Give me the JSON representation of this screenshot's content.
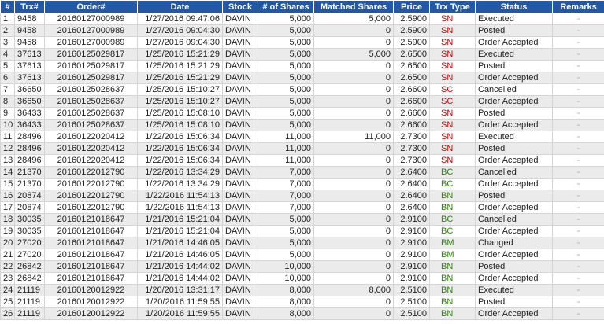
{
  "headers": [
    "#",
    "Trx#",
    "Order#",
    "Date",
    "Stock",
    "# of Shares",
    "Matched Shares",
    "Price",
    "Trx Type",
    "Status",
    "Remarks"
  ],
  "colors": {
    "header_bg": "#2358a6",
    "sell": "#d40000",
    "buy": "#2a8a00",
    "alt_row": "#ebebeb"
  },
  "rows": [
    {
      "no": "1",
      "trx": "9458",
      "order": "20160127000989",
      "date": "1/27/2016 09:47:06",
      "stock": "DAVIN",
      "shares": "5,000",
      "matched": "5,000",
      "price": "2.5900",
      "type": "SN",
      "status": "Executed",
      "remarks": "-"
    },
    {
      "no": "2",
      "trx": "9458",
      "order": "20160127000989",
      "date": "1/27/2016 09:04:30",
      "stock": "DAVIN",
      "shares": "5,000",
      "matched": "0",
      "price": "2.5900",
      "type": "SN",
      "status": "Posted",
      "remarks": "-"
    },
    {
      "no": "3",
      "trx": "9458",
      "order": "20160127000989",
      "date": "1/27/2016 09:04:30",
      "stock": "DAVIN",
      "shares": "5,000",
      "matched": "0",
      "price": "2.5900",
      "type": "SN",
      "status": "Order Accepted",
      "remarks": "-"
    },
    {
      "no": "4",
      "trx": "37613",
      "order": "20160125029817",
      "date": "1/25/2016 15:21:29",
      "stock": "DAVIN",
      "shares": "5,000",
      "matched": "5,000",
      "price": "2.6500",
      "type": "SN",
      "status": "Executed",
      "remarks": "-"
    },
    {
      "no": "5",
      "trx": "37613",
      "order": "20160125029817",
      "date": "1/25/2016 15:21:29",
      "stock": "DAVIN",
      "shares": "5,000",
      "matched": "0",
      "price": "2.6500",
      "type": "SN",
      "status": "Posted",
      "remarks": "-"
    },
    {
      "no": "6",
      "trx": "37613",
      "order": "20160125029817",
      "date": "1/25/2016 15:21:29",
      "stock": "DAVIN",
      "shares": "5,000",
      "matched": "0",
      "price": "2.6500",
      "type": "SN",
      "status": "Order Accepted",
      "remarks": "-"
    },
    {
      "no": "7",
      "trx": "36650",
      "order": "20160125028637",
      "date": "1/25/2016 15:10:27",
      "stock": "DAVIN",
      "shares": "5,000",
      "matched": "0",
      "price": "2.6600",
      "type": "SC",
      "status": "Cancelled",
      "remarks": "-"
    },
    {
      "no": "8",
      "trx": "36650",
      "order": "20160125028637",
      "date": "1/25/2016 15:10:27",
      "stock": "DAVIN",
      "shares": "5,000",
      "matched": "0",
      "price": "2.6600",
      "type": "SC",
      "status": "Order Accepted",
      "remarks": "-"
    },
    {
      "no": "9",
      "trx": "36433",
      "order": "20160125028637",
      "date": "1/25/2016 15:08:10",
      "stock": "DAVIN",
      "shares": "5,000",
      "matched": "0",
      "price": "2.6600",
      "type": "SN",
      "status": "Posted",
      "remarks": "-"
    },
    {
      "no": "10",
      "trx": "36433",
      "order": "20160125028637",
      "date": "1/25/2016 15:08:10",
      "stock": "DAVIN",
      "shares": "5,000",
      "matched": "0",
      "price": "2.6600",
      "type": "SN",
      "status": "Order Accepted",
      "remarks": "-"
    },
    {
      "no": "11",
      "trx": "28496",
      "order": "20160122020412",
      "date": "1/22/2016 15:06:34",
      "stock": "DAVIN",
      "shares": "11,000",
      "matched": "11,000",
      "price": "2.7300",
      "type": "SN",
      "status": "Executed",
      "remarks": "-"
    },
    {
      "no": "12",
      "trx": "28496",
      "order": "20160122020412",
      "date": "1/22/2016 15:06:34",
      "stock": "DAVIN",
      "shares": "11,000",
      "matched": "0",
      "price": "2.7300",
      "type": "SN",
      "status": "Posted",
      "remarks": "-"
    },
    {
      "no": "13",
      "trx": "28496",
      "order": "20160122020412",
      "date": "1/22/2016 15:06:34",
      "stock": "DAVIN",
      "shares": "11,000",
      "matched": "0",
      "price": "2.7300",
      "type": "SN",
      "status": "Order Accepted",
      "remarks": "-"
    },
    {
      "no": "14",
      "trx": "21370",
      "order": "20160122012790",
      "date": "1/22/2016 13:34:29",
      "stock": "DAVIN",
      "shares": "7,000",
      "matched": "0",
      "price": "2.6400",
      "type": "BC",
      "status": "Cancelled",
      "remarks": "-"
    },
    {
      "no": "15",
      "trx": "21370",
      "order": "20160122012790",
      "date": "1/22/2016 13:34:29",
      "stock": "DAVIN",
      "shares": "7,000",
      "matched": "0",
      "price": "2.6400",
      "type": "BC",
      "status": "Order Accepted",
      "remarks": "-"
    },
    {
      "no": "16",
      "trx": "20874",
      "order": "20160122012790",
      "date": "1/22/2016 11:54:13",
      "stock": "DAVIN",
      "shares": "7,000",
      "matched": "0",
      "price": "2.6400",
      "type": "BN",
      "status": "Posted",
      "remarks": "-"
    },
    {
      "no": "17",
      "trx": "20874",
      "order": "20160122012790",
      "date": "1/22/2016 11:54:13",
      "stock": "DAVIN",
      "shares": "7,000",
      "matched": "0",
      "price": "2.6400",
      "type": "BN",
      "status": "Order Accepted",
      "remarks": "-"
    },
    {
      "no": "18",
      "trx": "30035",
      "order": "20160121018647",
      "date": "1/21/2016 15:21:04",
      "stock": "DAVIN",
      "shares": "5,000",
      "matched": "0",
      "price": "2.9100",
      "type": "BC",
      "status": "Cancelled",
      "remarks": "-"
    },
    {
      "no": "19",
      "trx": "30035",
      "order": "20160121018647",
      "date": "1/21/2016 15:21:04",
      "stock": "DAVIN",
      "shares": "5,000",
      "matched": "0",
      "price": "2.9100",
      "type": "BC",
      "status": "Order Accepted",
      "remarks": "-"
    },
    {
      "no": "20",
      "trx": "27020",
      "order": "20160121018647",
      "date": "1/21/2016 14:46:05",
      "stock": "DAVIN",
      "shares": "5,000",
      "matched": "0",
      "price": "2.9100",
      "type": "BM",
      "status": "Changed",
      "remarks": "-"
    },
    {
      "no": "21",
      "trx": "27020",
      "order": "20160121018647",
      "date": "1/21/2016 14:46:05",
      "stock": "DAVIN",
      "shares": "5,000",
      "matched": "0",
      "price": "2.9100",
      "type": "BM",
      "status": "Order Accepted",
      "remarks": "-"
    },
    {
      "no": "22",
      "trx": "26842",
      "order": "20160121018647",
      "date": "1/21/2016 14:44:02",
      "stock": "DAVIN",
      "shares": "10,000",
      "matched": "0",
      "price": "2.9100",
      "type": "BN",
      "status": "Posted",
      "remarks": "-"
    },
    {
      "no": "23",
      "trx": "26842",
      "order": "20160121018647",
      "date": "1/21/2016 14:44:02",
      "stock": "DAVIN",
      "shares": "10,000",
      "matched": "0",
      "price": "2.9100",
      "type": "BN",
      "status": "Order Accepted",
      "remarks": "-"
    },
    {
      "no": "24",
      "trx": "21119",
      "order": "20160120012922",
      "date": "1/20/2016 13:31:17",
      "stock": "DAVIN",
      "shares": "8,000",
      "matched": "8,000",
      "price": "2.5100",
      "type": "BN",
      "status": "Executed",
      "remarks": "-"
    },
    {
      "no": "25",
      "trx": "21119",
      "order": "20160120012922",
      "date": "1/20/2016 11:59:55",
      "stock": "DAVIN",
      "shares": "8,000",
      "matched": "0",
      "price": "2.5100",
      "type": "BN",
      "status": "Posted",
      "remarks": "-"
    },
    {
      "no": "26",
      "trx": "21119",
      "order": "20160120012922",
      "date": "1/20/2016 11:59:55",
      "stock": "DAVIN",
      "shares": "8,000",
      "matched": "0",
      "price": "2.5100",
      "type": "BN",
      "status": "Order Accepted",
      "remarks": "-"
    }
  ]
}
